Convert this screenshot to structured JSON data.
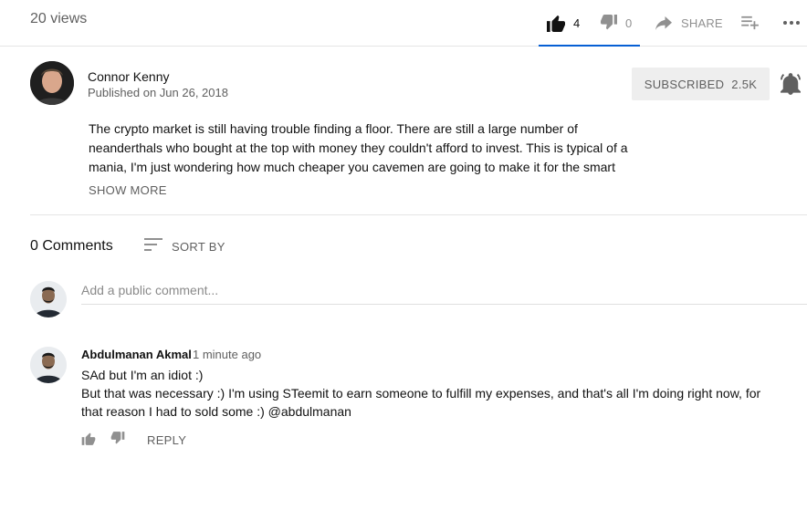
{
  "video": {
    "views": "20 views",
    "like_count": "4",
    "dislike_count": "0",
    "share_label": "SHARE"
  },
  "channel": {
    "name": "Connor Kenny",
    "published": "Published on Jun 26, 2018",
    "subscribe_label": "SUBSCRIBED",
    "subscriber_count": "2.5K"
  },
  "description": {
    "lines": [
      "The crypto market is still having trouble finding a floor. There are still a large number of",
      "neanderthals who bought at the top with money they couldn't afford to invest. This is typical of a",
      "mania, I'm just wondering how much cheaper you cavemen are going to make it for the smart"
    ],
    "show_more_label": "SHOW MORE"
  },
  "comments": {
    "count_label": "0 Comments",
    "sort_label": "SORT BY",
    "add_placeholder": "Add a public comment...",
    "items": [
      {
        "author": "Abdulmanan Akmal",
        "time": "1 minute ago",
        "lines": [
          "SAd but I'm an idiot :)",
          "But that was necessary :) I'm using STeemit to earn someone to fulfill my expenses, and that's all I'm doing right now, for that reason I had to sold some :) @abdulmanan"
        ],
        "reply_label": "REPLY"
      }
    ]
  },
  "icons": {
    "like": "thumb-up-icon",
    "dislike": "thumb-down-icon",
    "share": "share-arrow-icon",
    "add_to_playlist": "playlist-add-icon",
    "more": "more-horiz-icon",
    "notifications": "bell-icon",
    "sort": "sort-icon"
  },
  "colors": {
    "accent": "#065fd4",
    "text_primary": "#111111",
    "text_secondary": "#606060",
    "icon_gray": "#909090",
    "subscribed_bg": "#eeeeee"
  }
}
